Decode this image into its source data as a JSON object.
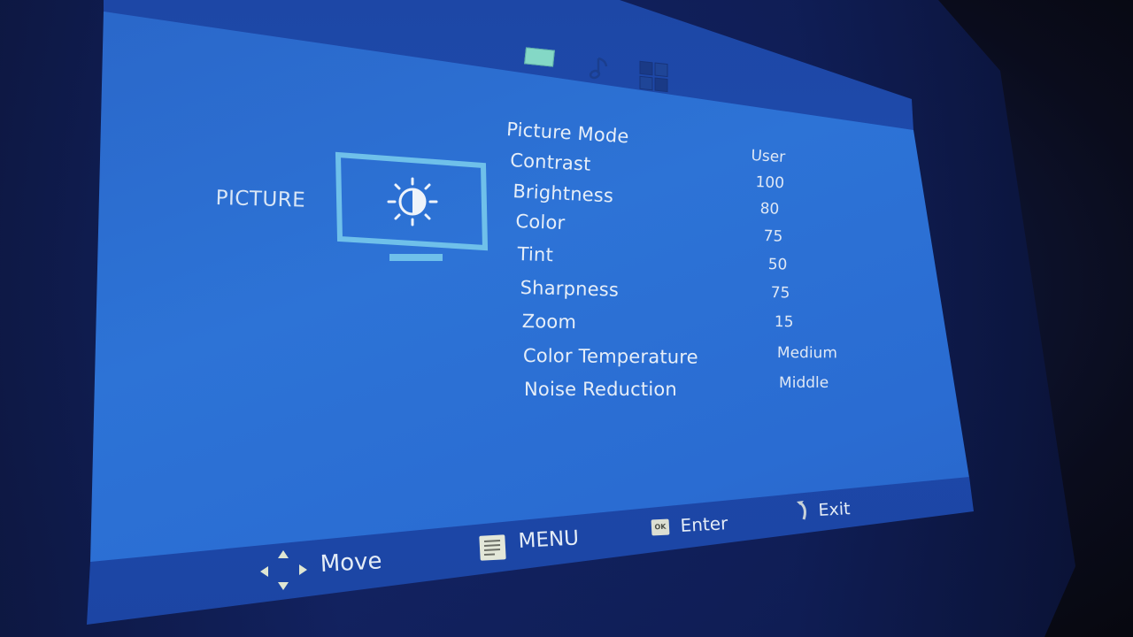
{
  "osd": {
    "tabs": [
      {
        "name": "picture",
        "icon": "picture-tab-icon",
        "active": true
      },
      {
        "name": "sound",
        "icon": "music-note-icon",
        "active": false
      },
      {
        "name": "settings",
        "icon": "grid-icon",
        "active": false
      }
    ],
    "section_title": "PICTURE",
    "section_icon": "monitor-brightness-icon",
    "items": [
      {
        "label": "Picture Mode",
        "value": "User"
      },
      {
        "label": "Contrast",
        "value": "100"
      },
      {
        "label": "Brightness",
        "value": "80"
      },
      {
        "label": "Color",
        "value": "75"
      },
      {
        "label": "Tint",
        "value": "50"
      },
      {
        "label": "Sharpness",
        "value": "75"
      },
      {
        "label": "Zoom",
        "value": "15"
      },
      {
        "label": "Color Temperature",
        "value": "Medium"
      },
      {
        "label": "Noise Reduction",
        "value": "Middle"
      }
    ],
    "footer": {
      "move": {
        "label": "Move",
        "icon": "dpad-arrows-icon"
      },
      "menu": {
        "label": "MENU",
        "icon": "menu-list-icon"
      },
      "enter": {
        "label": "Enter",
        "icon": "ok-button-icon",
        "icon_text": "OK"
      },
      "exit": {
        "label": "Exit",
        "icon": "return-arrow-icon"
      }
    },
    "colors": {
      "screen_blue": "#2d6fd4",
      "header_blue": "#1f4db0",
      "active_tab": "#7fd6c8",
      "icon_cyan": "#7fc4ec",
      "text": "#e6eef8"
    }
  }
}
